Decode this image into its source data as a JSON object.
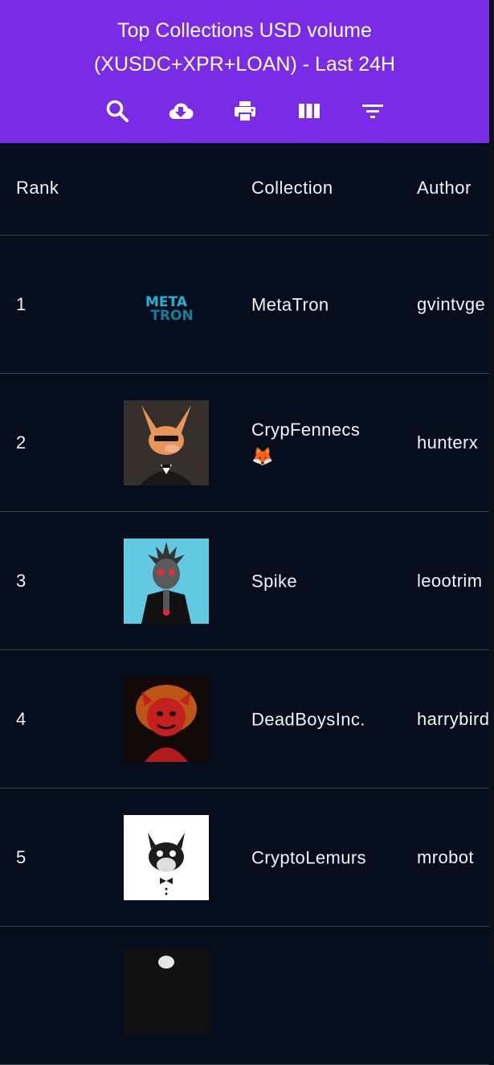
{
  "header": {
    "title_line1": "Top Collections USD volume",
    "title_line2": "(XUSDC+XPR+LOAN) - Last 24H",
    "toolbar": [
      {
        "icon": "search-icon"
      },
      {
        "icon": "download-icon"
      },
      {
        "icon": "print-icon"
      },
      {
        "icon": "view-columns-icon"
      },
      {
        "icon": "filter-icon"
      }
    ]
  },
  "table": {
    "columns": [
      "Rank",
      "",
      "Collection",
      "Author"
    ],
    "rows": [
      {
        "rank": "1",
        "collection": "MetaTron",
        "collection_extra": "",
        "author": "gvintvge",
        "logo_text_1": "META",
        "logo_text_2": "TRON"
      },
      {
        "rank": "2",
        "collection": "CrypFennecs",
        "collection_extra": "🦊",
        "author": "hunterx"
      },
      {
        "rank": "3",
        "collection": "Spike",
        "collection_extra": "",
        "author": "leootrim"
      },
      {
        "rank": "4",
        "collection": "DeadBoysInc.",
        "collection_extra": "",
        "author": "harrybird"
      },
      {
        "rank": "5",
        "collection": "CryptoLemurs",
        "collection_extra": "",
        "author": "mrobot"
      }
    ]
  },
  "colors": {
    "header_bg": "#7a2be6",
    "page_bg": "#060d1d",
    "row_divider": "#3b4250"
  }
}
